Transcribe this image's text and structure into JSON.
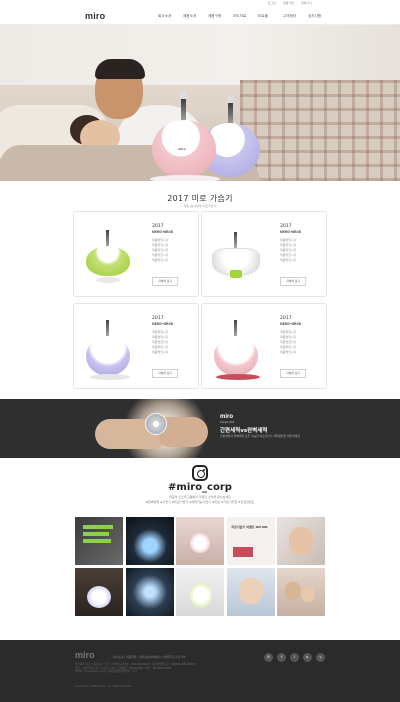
{
  "util_links": [
    "로그인",
    "회원가입",
    "장바구니"
  ],
  "nav": {
    "logo": "miro",
    "menu": [
      "회사소개",
      "제품소개",
      "제품구매",
      "보도자료",
      "미로몰",
      "고객센터",
      "공지사항"
    ]
  },
  "hero": {
    "product_label": "miro"
  },
  "section": {
    "title": "2017 미로 가습기",
    "subtitle": "편안 숨쉬세게 미로가습기"
  },
  "products": [
    {
      "year": "2017",
      "model": "NERO-NR08",
      "specs": [
        "제품명입니다",
        "제품명입니다",
        "제품명입니다",
        "제품명입니다",
        "제품명입니다"
      ],
      "button": "자세히 보기"
    },
    {
      "year": "2017",
      "model": "NERO-NR08",
      "specs": [
        "제품명입니다",
        "제품명입니다",
        "제품명입니다",
        "제품명입니다",
        "제품명입니다"
      ],
      "button": "자세히 보기"
    },
    {
      "year": "2017",
      "model": "NERO-NR08",
      "specs": [
        "제품명입니다",
        "제품명입니다",
        "제품명입니다",
        "제품명입니다",
        "제품명입니다"
      ],
      "button": "자세히 보기"
    },
    {
      "year": "2017",
      "model": "NERO-NR08",
      "specs": [
        "제품명입니다",
        "제품명입니다",
        "제품명입니다",
        "제품명입니다",
        "제품명입니다"
      ],
      "button": "자세히 보기"
    }
  ],
  "band": {
    "brand": "miro",
    "brand_sub": "Clean Pot",
    "heading": "간편세척vs완벽세척",
    "desc": "간편세척과 완벽세척 모두 가능한 미로가습기 세척방법을 확인하세요"
  },
  "instagram": {
    "handle": "#miro_corp",
    "desc1": "미로의 인스타그램에서 다양한 소식을 만나보세요",
    "desc2": "#완벽세척 #가습기 #미로가습기 #세척가능가습기 #미로 #가습기추천 #건강한습도"
  },
  "gallery": [
    {
      "text": ""
    },
    {
      "text": ""
    },
    {
      "text": ""
    },
    {
      "text": "미로가습기 이벤트 ON AIR"
    },
    {
      "text": ""
    },
    {
      "text": ""
    },
    {
      "text": ""
    },
    {
      "text": ""
    },
    {
      "text": ""
    },
    {
      "text": ""
    }
  ],
  "footer": {
    "logo": "miro",
    "nav": "회사소개 | 이용약관 | 개인정보처리방침 | 이메일무단수집거부",
    "info": [
      "주식회사 미로 | 대표이사 : 미로 | 사업자등록번호 : 000-00-00000 | 통신판매업신고 : 제0000-서울-0000호",
      "주소 : 서울특별시 미로구 미로로 00 | 고객센터 : 0000-0000 | 팩스 : 00-0000-0000",
      "이메일 : miro@miro.co.kr | 개인정보관리책임자 : 미로"
    ],
    "copy": "Copyright © MIRO Corp. All rights reserved.",
    "social": [
      "B",
      "f",
      "i",
      "▶",
      "y"
    ]
  },
  "colors": {
    "accent_red": "#d04f4f",
    "band_bg": "#2f2f2f",
    "footer_bg": "#2b2b2b"
  }
}
